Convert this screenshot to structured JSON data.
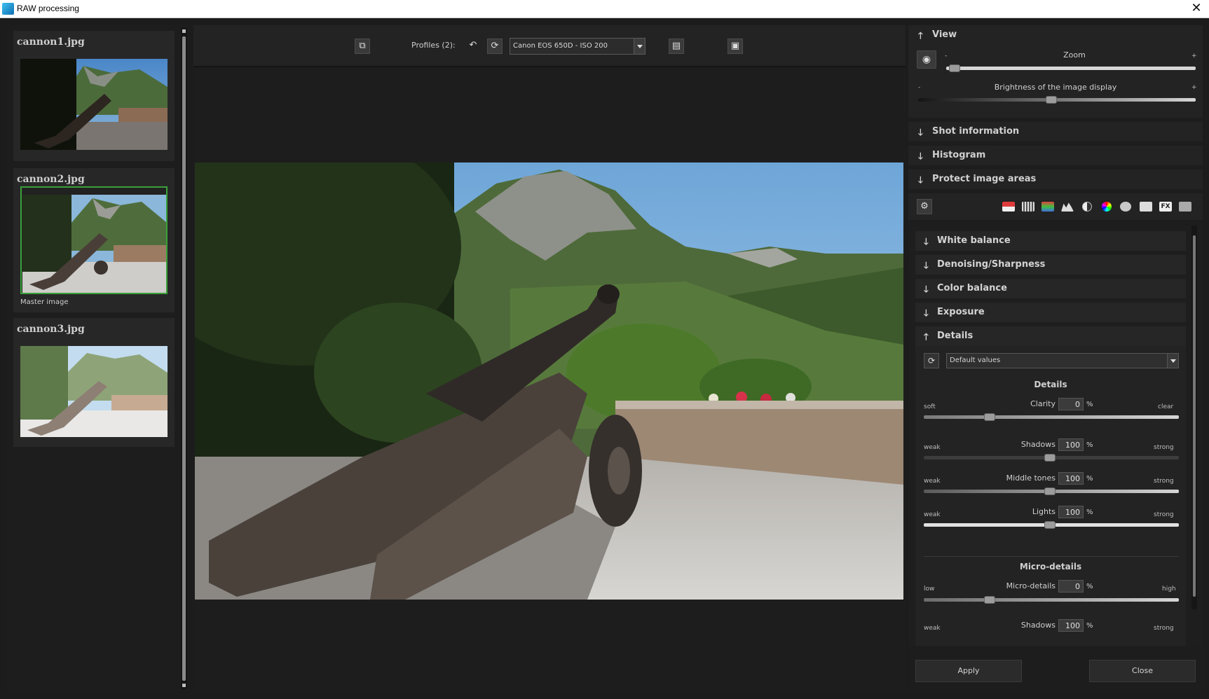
{
  "window": {
    "title": "RAW processing",
    "close": "✕"
  },
  "filmstrip": {
    "items": [
      {
        "name": "cannon1.jpg",
        "note": ""
      },
      {
        "name": "cannon2.jpg",
        "note": "Master image"
      },
      {
        "name": "cannon3.jpg",
        "note": ""
      }
    ]
  },
  "toolbar": {
    "profiles_label": "Profiles (2):",
    "profile_value": "Canon EOS 650D - ISO 200"
  },
  "right": {
    "view": {
      "title": "View",
      "zoom_label": "Zoom",
      "zoom_minus": "-",
      "zoom_plus": "+",
      "brightness_label": "Brightness of the image display",
      "brightness_minus": "-",
      "brightness_plus": "+"
    },
    "sections": [
      "Shot information",
      "Histogram",
      "Protect image areas"
    ],
    "settings": {
      "sections": [
        "White balance",
        "Denoising/Sharpness",
        "Color balance",
        "Exposure",
        "Details"
      ],
      "preset": "Default values",
      "details_title": "Details",
      "clarity": {
        "label": "Clarity",
        "value": "0",
        "unit": "%",
        "low": "soft",
        "high": "clear"
      },
      "shadows": {
        "label": "Shadows",
        "value": "100",
        "unit": "%",
        "low": "weak",
        "high": "strong"
      },
      "middle": {
        "label": "Middle tones",
        "value": "100",
        "unit": "%",
        "low": "weak",
        "high": "strong"
      },
      "lights": {
        "label": "Lights",
        "value": "100",
        "unit": "%",
        "low": "weak",
        "high": "strong"
      },
      "micro_title": "Micro-details",
      "micro": {
        "label": "Micro-details",
        "value": "0",
        "unit": "%",
        "low": "low",
        "high": "high"
      },
      "micro_shadows": {
        "label": "Shadows",
        "value": "100",
        "unit": "%",
        "low": "weak",
        "high": "strong"
      }
    },
    "apply": "Apply",
    "close": "Close"
  }
}
